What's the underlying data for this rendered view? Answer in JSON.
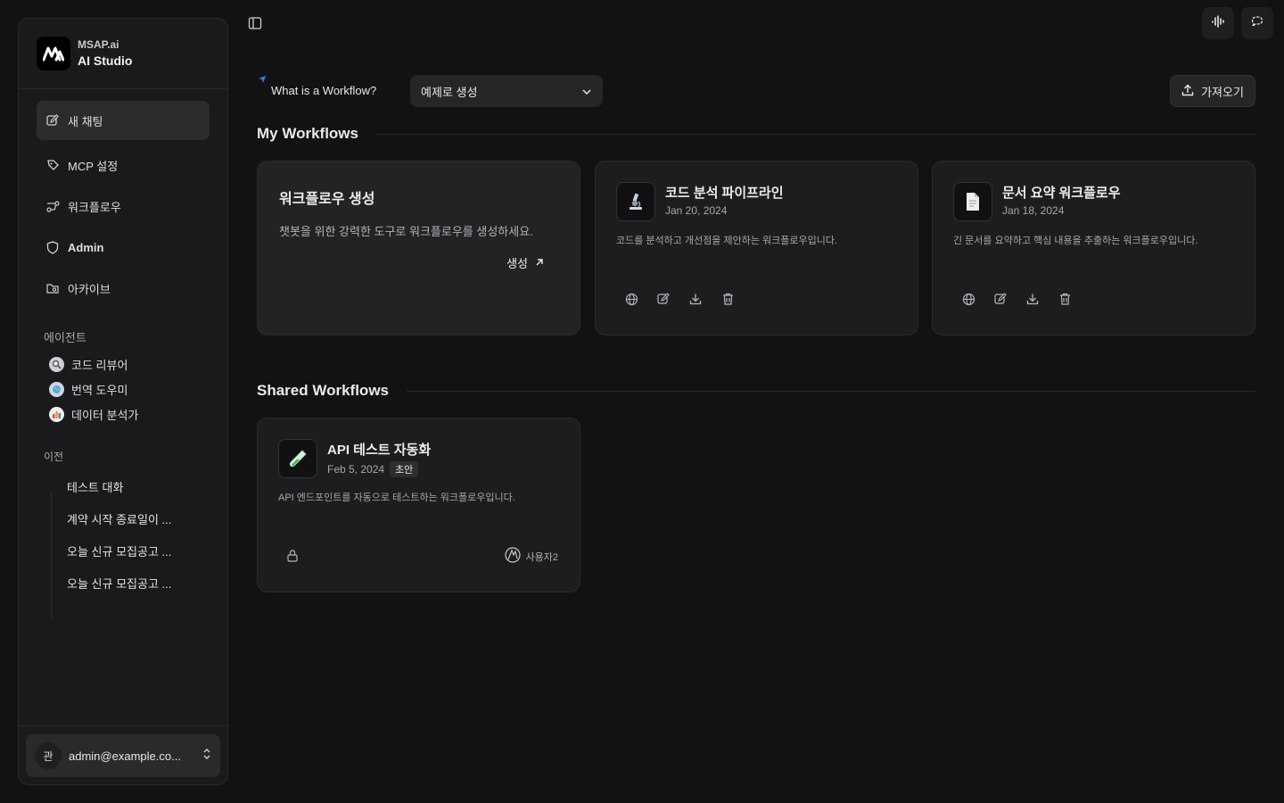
{
  "brand": {
    "name": "MSAP.ai",
    "product": "AI Studio"
  },
  "nav": [
    {
      "label": "새 채팅",
      "icon": "edit-icon",
      "active": true
    },
    {
      "label": "MCP 설정",
      "icon": "tag-icon"
    },
    {
      "label": "워크플로우",
      "icon": "workflow-icon"
    },
    {
      "label": "Admin",
      "icon": "shield-icon"
    },
    {
      "label": "아카이브",
      "icon": "archive-icon"
    }
  ],
  "agents": {
    "label": "에이전트",
    "items": [
      {
        "label": "코드 리뷰어",
        "icon": "magnifier-icon"
      },
      {
        "label": "번역 도우미",
        "icon": "globe-icon"
      },
      {
        "label": "데이터 분석가",
        "icon": "bar-chart-icon"
      }
    ]
  },
  "history": {
    "label": "이전",
    "items": [
      {
        "label": "테스트 대화"
      },
      {
        "label": "계약 시작 종료일이 ..."
      },
      {
        "label": "오늘 신규 모집공고 ..."
      },
      {
        "label": "오늘 신규 모집공고 ..."
      }
    ]
  },
  "user": {
    "avatar": "관",
    "email": "admin@example.co..."
  },
  "toolbar": {
    "what_label": "What is a Workflow?",
    "select_value": "예제로 생성",
    "import_label": "가져오기"
  },
  "my_workflows": {
    "title": "My Workflows",
    "create": {
      "title": "워크플로우 생성",
      "desc": "챗봇을 위한 강력한 도구로 워크플로우를 생성하세요.",
      "link": "생성"
    },
    "items": [
      {
        "title": "코드 분석 파이프라인",
        "date": "Jan 20, 2024",
        "desc": "코드를 분석하고 개선점을 제안하는 워크플로우입니다.",
        "icon": "microscope-icon"
      },
      {
        "title": "문서 요약 워크플로우",
        "date": "Jan 18, 2024",
        "desc": "긴 문서를 요약하고 핵심 내용을 추출하는 워크플로우입니다.",
        "icon": "document-icon"
      }
    ]
  },
  "shared_workflows": {
    "title": "Shared Workflows",
    "items": [
      {
        "title": "API 테스트 자동화",
        "date": "Feb 5, 2024",
        "badge": "초안",
        "desc": "API 엔드포인트를 자동으로 테스트하는 워크플로우입니다.",
        "owner": "사용자2",
        "icon": "test-tube-icon"
      }
    ]
  }
}
